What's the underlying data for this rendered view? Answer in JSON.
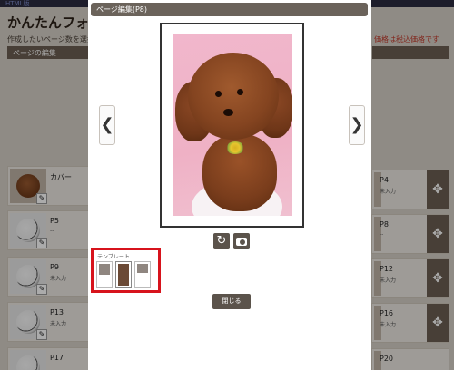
{
  "background": {
    "top_strip_text": "HTML版",
    "title": "かんたんフォトブ",
    "subtitle": "作成したいページ数を選択し",
    "note_right": "価格は税込価格です",
    "section_bar": "ページの編集",
    "left_cards": [
      {
        "label": "カバー",
        "sub": ""
      },
      {
        "label": "P5",
        "sub": "--"
      },
      {
        "label": "P9",
        "sub": "未入力"
      },
      {
        "label": "P13",
        "sub": "未入力"
      },
      {
        "label": "P17",
        "sub": ""
      }
    ],
    "right_cards": [
      {
        "label": "P4",
        "sub": "未入力"
      },
      {
        "label": "P8",
        "sub": "--"
      },
      {
        "label": "P12",
        "sub": "未入力"
      },
      {
        "label": "P16",
        "sub": "未入力"
      },
      {
        "label": "P20",
        "sub": ""
      }
    ],
    "edit_glyph": "✎",
    "move_glyph": "✥"
  },
  "modal": {
    "header_title": "ページ編集(P8)",
    "prev_glyph": "❮",
    "next_glyph": "❯",
    "rotate_glyph": "↻",
    "template_label": "テンプレート",
    "close_label": "閉じる"
  },
  "icons": {
    "prev": "chevron-left-icon",
    "next": "chevron-right-icon",
    "rotate": "rotate-icon",
    "camera": "camera-icon"
  },
  "colors": {
    "modal_header": "#6b635b",
    "button_dark": "#5b534b",
    "highlight_border": "#d7131c",
    "photo_background": "#f1b7cc"
  }
}
